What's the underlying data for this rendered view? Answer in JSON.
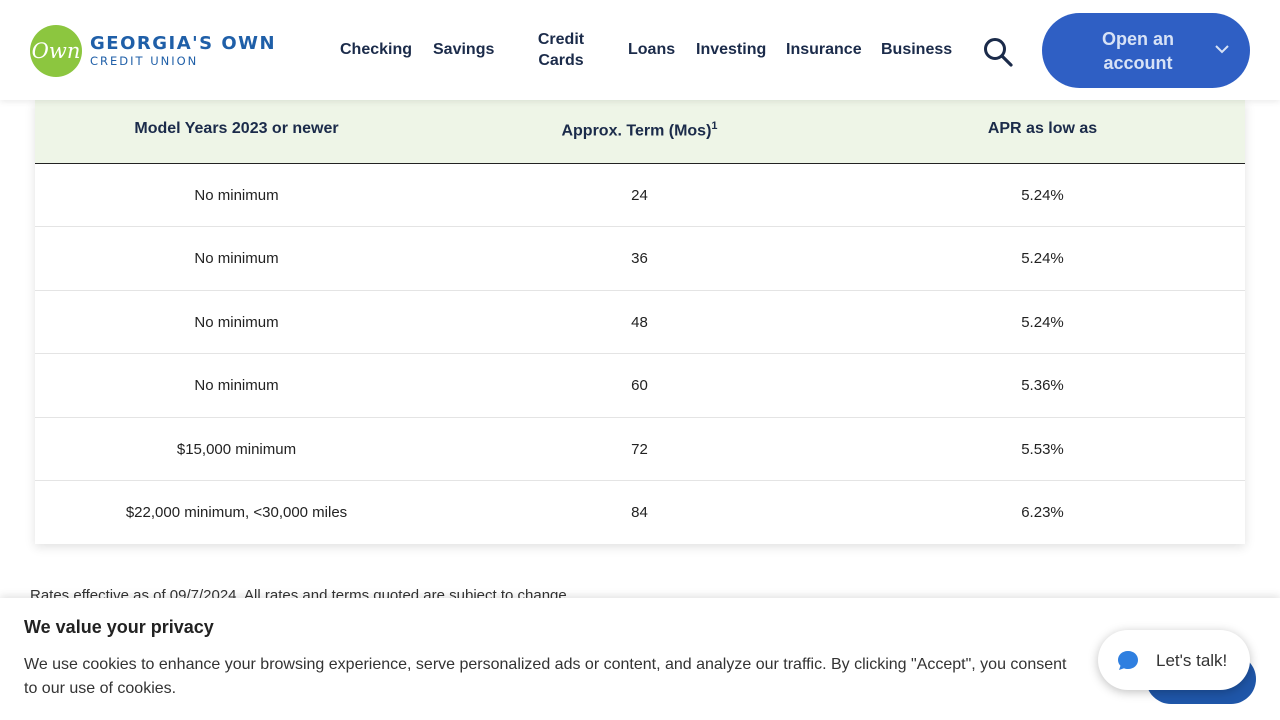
{
  "header": {
    "logo_mark": "Own",
    "logo_line1": "GEORGIA'S OWN",
    "logo_line2": "CREDIT UNION",
    "nav": [
      {
        "label": "Checking"
      },
      {
        "label": "Savings"
      },
      {
        "label_line1": "Credit",
        "label_line2": "Cards"
      },
      {
        "label": "Loans"
      },
      {
        "label": "Investing"
      },
      {
        "label": "Insurance"
      },
      {
        "label": "Business"
      }
    ],
    "search_icon": "search-icon",
    "cta_line1": "Open an",
    "cta_line2": "account",
    "cta_icon": "chevron-down-icon",
    "colors": {
      "brand_blue": "#1f5fa8",
      "logo_green": "#8cc63f",
      "cta_blue": "#2f5fc4"
    }
  },
  "table": {
    "columns": [
      "Model Years 2023 or newer",
      "Approx. Term (Mos)",
      "APR as low as"
    ],
    "term_footnote": "1",
    "rows": [
      [
        "No minimum",
        "24",
        "5.24%"
      ],
      [
        "No minimum",
        "36",
        "5.24%"
      ],
      [
        "No minimum",
        "48",
        "5.24%"
      ],
      [
        "No minimum",
        "60",
        "5.36%"
      ],
      [
        "$15,000 minimum",
        "72",
        "5.53%"
      ],
      [
        "$22,000 minimum, <30,000 miles",
        "84",
        "6.23%"
      ]
    ],
    "header_bg": "#eef5e7"
  },
  "rates_note": "Rates effective as of 09/7/2024. All rates and terms quoted are subject to change.",
  "cookie": {
    "title": "We value your privacy",
    "text": "We use cookies to enhance your browsing experience, serve personalized ads or content, and analyze our traffic. By clicking \"Accept\", you consent to our use of cookies."
  },
  "chat": {
    "label": "Let's talk!",
    "icon": "chat-bubble-icon"
  }
}
